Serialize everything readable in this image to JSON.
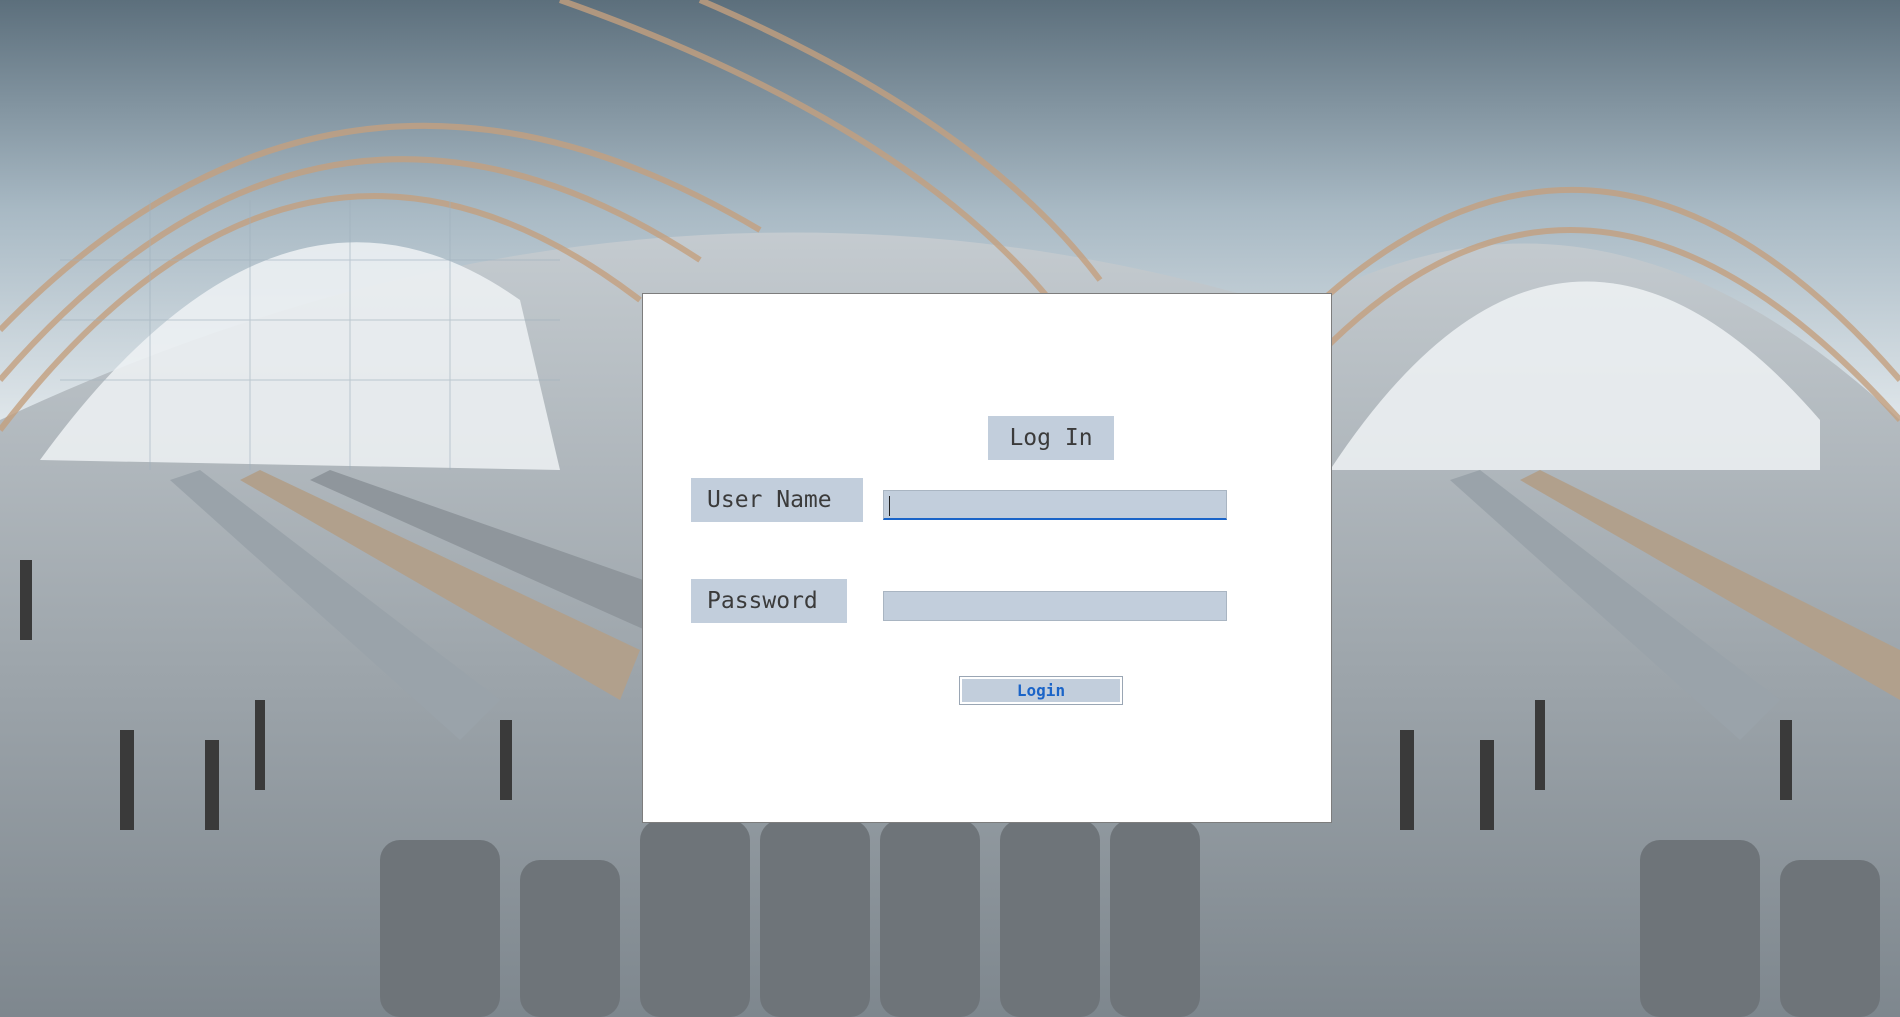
{
  "background": {
    "description_icon": "train-station-background-image"
  },
  "login_dialog": {
    "title": "Log In",
    "username_label": "User Name",
    "username_value": "",
    "password_label": "Password",
    "password_value": "",
    "login_button_label": "Login"
  },
  "colors": {
    "label_bg": "#c2cedc",
    "label_text": "#3b3b3b",
    "button_text": "#1a64c8",
    "focus_underline": "#1a64c8"
  }
}
